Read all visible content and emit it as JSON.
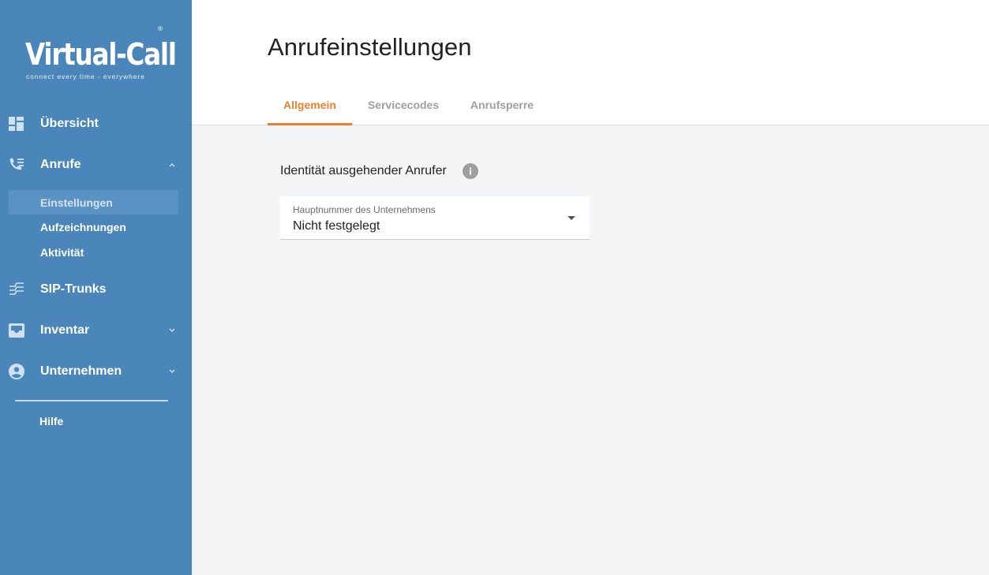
{
  "brand": {
    "name": "Virtual-Call",
    "registered": "®",
    "tagline": "connect every time - everywhere"
  },
  "sidebar": {
    "items": [
      {
        "label": "Übersicht",
        "icon": "dashboard-icon"
      },
      {
        "label": "Anrufe",
        "icon": "phone-list-icon",
        "expanded": true
      },
      {
        "label": "SIP-Trunks",
        "icon": "sip-trunk-icon"
      },
      {
        "label": "Inventar",
        "icon": "inbox-icon",
        "expanded": false
      },
      {
        "label": "Unternehmen",
        "icon": "account-circle-icon",
        "expanded": false
      }
    ],
    "calls_submenu": [
      {
        "label": "Einstellungen",
        "active": true
      },
      {
        "label": "Aufzeichnungen"
      },
      {
        "label": "Aktivität"
      }
    ],
    "help_label": "Hilfe"
  },
  "header": {
    "title": "Anrufeinstellungen",
    "tabs": [
      {
        "label": "Allgemein",
        "active": true
      },
      {
        "label": "Servicecodes"
      },
      {
        "label": "Anrufsperre"
      }
    ]
  },
  "main": {
    "section_title": "Identität ausgehender Anrufer",
    "select": {
      "label": "Hauptnummer des Unternehmens",
      "value": "Nicht festgelegt"
    }
  },
  "colors": {
    "sidebar_bg": "#4a86ba",
    "accent": "#ee7f2f",
    "page_bg": "#f4f5f7"
  }
}
